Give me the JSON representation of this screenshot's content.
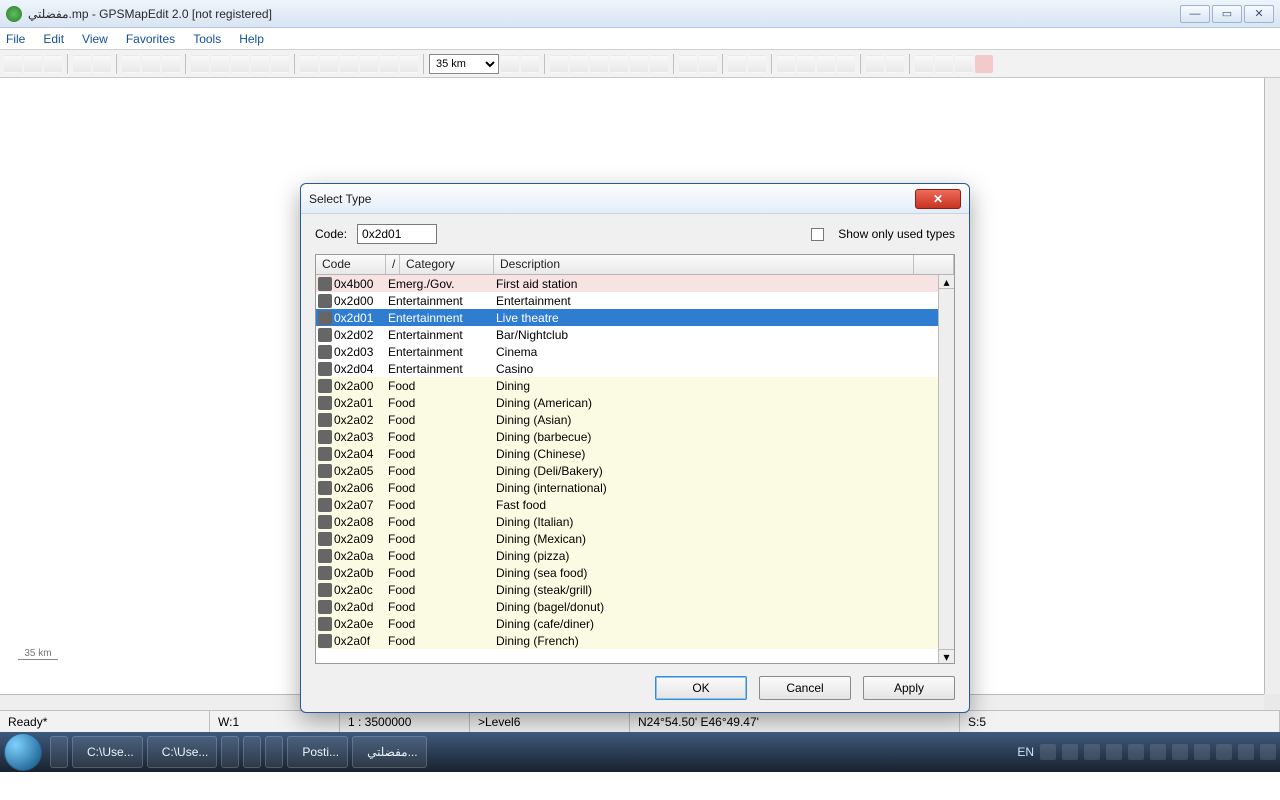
{
  "window": {
    "title": "مفضلتي.mp - GPSMapEdit 2.0 [not registered]"
  },
  "menu": {
    "file": "File",
    "edit": "Edit",
    "view": "View",
    "favorites": "Favorites",
    "tools": "Tools",
    "help": "Help"
  },
  "toolbar": {
    "zoom_value": "35 km"
  },
  "scale_label": "35 km",
  "status": {
    "ready": "Ready*",
    "w": "W:1",
    "ratio": "1 : 3500000",
    "level": ">Level6",
    "coord": "N24°54.50' E46°49.47'",
    "s": "S:5"
  },
  "dialog": {
    "title": "Select Type",
    "code_label": "Code:",
    "code_value": "0x2d01",
    "show_only": "Show only used types",
    "hdr_code": "Code",
    "hdr_cat": "Category",
    "hdr_desc": "Description",
    "ok": "OK",
    "cancel": "Cancel",
    "apply": "Apply",
    "rows": [
      {
        "code": "0x4b00",
        "cat": "Emerg./Gov.",
        "desc": "First aid station",
        "cls": "emerg"
      },
      {
        "code": "0x2d00",
        "cat": "Entertainment",
        "desc": "Entertainment",
        "cls": "ent"
      },
      {
        "code": "0x2d01",
        "cat": "Entertainment",
        "desc": "Live theatre",
        "cls": "sel"
      },
      {
        "code": "0x2d02",
        "cat": "Entertainment",
        "desc": "Bar/Nightclub",
        "cls": "ent"
      },
      {
        "code": "0x2d03",
        "cat": "Entertainment",
        "desc": "Cinema",
        "cls": "ent"
      },
      {
        "code": "0x2d04",
        "cat": "Entertainment",
        "desc": "Casino",
        "cls": "ent"
      },
      {
        "code": "0x2a00",
        "cat": "Food",
        "desc": "Dining",
        "cls": "food"
      },
      {
        "code": "0x2a01",
        "cat": "Food",
        "desc": "Dining (American)",
        "cls": "food"
      },
      {
        "code": "0x2a02",
        "cat": "Food",
        "desc": "Dining (Asian)",
        "cls": "food"
      },
      {
        "code": "0x2a03",
        "cat": "Food",
        "desc": "Dining (barbecue)",
        "cls": "food"
      },
      {
        "code": "0x2a04",
        "cat": "Food",
        "desc": "Dining (Chinese)",
        "cls": "food"
      },
      {
        "code": "0x2a05",
        "cat": "Food",
        "desc": "Dining (Deli/Bakery)",
        "cls": "food"
      },
      {
        "code": "0x2a06",
        "cat": "Food",
        "desc": "Dining (international)",
        "cls": "food"
      },
      {
        "code": "0x2a07",
        "cat": "Food",
        "desc": "Fast food",
        "cls": "food"
      },
      {
        "code": "0x2a08",
        "cat": "Food",
        "desc": "Dining (Italian)",
        "cls": "food"
      },
      {
        "code": "0x2a09",
        "cat": "Food",
        "desc": "Dining (Mexican)",
        "cls": "food"
      },
      {
        "code": "0x2a0a",
        "cat": "Food",
        "desc": "Dining (pizza)",
        "cls": "food"
      },
      {
        "code": "0x2a0b",
        "cat": "Food",
        "desc": "Dining (sea food)",
        "cls": "food"
      },
      {
        "code": "0x2a0c",
        "cat": "Food",
        "desc": "Dining (steak/grill)",
        "cls": "food"
      },
      {
        "code": "0x2a0d",
        "cat": "Food",
        "desc": "Dining (bagel/donut)",
        "cls": "food"
      },
      {
        "code": "0x2a0e",
        "cat": "Food",
        "desc": "Dining (cafe/diner)",
        "cls": "food"
      },
      {
        "code": "0x2a0f",
        "cat": "Food",
        "desc": "Dining (French)",
        "cls": "food"
      }
    ]
  },
  "taskbar": {
    "items": [
      "",
      "C:\\Use...",
      "C:\\Use...",
      "",
      "",
      "",
      "Posti...",
      "مفضلتي..."
    ],
    "lang": "EN"
  }
}
